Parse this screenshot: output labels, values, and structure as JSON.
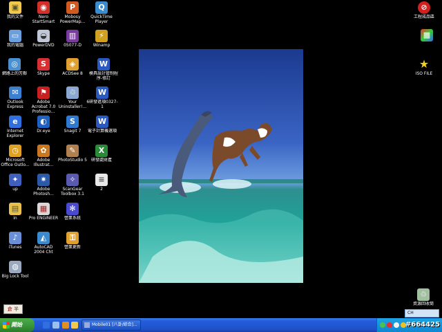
{
  "desktop_icons": [
    {
      "label": "我的文件",
      "icon": "folder-documents-icon",
      "color": "#f2c94c",
      "glyph": "▣"
    },
    {
      "label": "我的電腦",
      "icon": "computer-icon",
      "color": "#6aa0e0",
      "glyph": "▭"
    },
    {
      "label": "網路上的芳鄰",
      "icon": "network-icon",
      "color": "#4a90d0",
      "glyph": "◎"
    },
    {
      "label": "Outlook Express",
      "icon": "outlook-express-icon",
      "color": "#3a7fd0",
      "glyph": "✉"
    },
    {
      "label": "Internet Explorer",
      "icon": "internet-explorer-icon",
      "color": "#2f6fe0",
      "glyph": "e"
    },
    {
      "label": "Microsoft Office Outlo...",
      "icon": "outlook-icon",
      "color": "#e0a020",
      "glyph": "◷"
    },
    {
      "label": "up",
      "icon": "app-icon",
      "color": "#4060c0",
      "glyph": "✦"
    },
    {
      "label": "in",
      "icon": "folder-icon",
      "color": "#e9c04a",
      "glyph": "▤"
    },
    {
      "label": "iTunes",
      "icon": "itunes-icon",
      "color": "#6a8fd8",
      "glyph": "♪"
    },
    {
      "label": "Big Lock Tool",
      "icon": "lock-tool-icon",
      "color": "#9aa8c0",
      "glyph": "◍"
    },
    {
      "label": "Nero StartSmart",
      "icon": "nero-icon",
      "color": "#d0302a",
      "glyph": "◉"
    },
    {
      "label": "PowerDVD",
      "icon": "powerdvd-icon",
      "color": "#c0c8d8",
      "glyph": "◒"
    },
    {
      "label": "Skype",
      "icon": "skype-icon",
      "color": "#d83030",
      "glyph": "S"
    },
    {
      "label": "Adobe Acrobat 7.0 Professio...",
      "icon": "acrobat-icon",
      "color": "#c82020",
      "glyph": "⚑"
    },
    {
      "label": "Dr.eye",
      "icon": "dreye-icon",
      "color": "#2060c0",
      "glyph": "◐"
    },
    {
      "label": "Adobe Illustrat...",
      "icon": "illustrator-icon",
      "color": "#c87820",
      "glyph": "✿"
    },
    {
      "label": "Adobe Photosh...",
      "icon": "photoshop-icon",
      "color": "#2a5aa8",
      "glyph": "✷"
    },
    {
      "label": "Pro ENGINEER",
      "icon": "pro-engineer-icon",
      "color": "#d8d8d8",
      "glyph": "▦"
    },
    {
      "label": "AutoCAD 2004 Cht",
      "icon": "autocad-icon",
      "color": "#3a8ad0",
      "glyph": "◭"
    },
    {
      "label": "Mobosy PowerMap...",
      "icon": "powermap-icon",
      "color": "#d05a20",
      "glyph": "P"
    },
    {
      "label": "05077-D",
      "icon": "archive-icon",
      "color": "#7a3aa0",
      "glyph": "▥"
    },
    {
      "label": "ACDSee 8",
      "icon": "acdsee-icon",
      "color": "#e0a030",
      "glyph": "◈"
    },
    {
      "label": "Your Uninstaller!...",
      "icon": "recycle-bin-icon",
      "color": "#8aa8d0",
      "glyph": "♲"
    },
    {
      "label": "Snagit 7",
      "icon": "snagit-icon",
      "color": "#2f7ad0",
      "glyph": "S"
    },
    {
      "label": "PhotoStudio 5",
      "icon": "photostudio-icon",
      "color": "#b08050",
      "glyph": "✎"
    },
    {
      "label": "ScanGear Toolbox 3.1",
      "icon": "scangear-icon",
      "color": "#5a5ab0",
      "glyph": "✧"
    },
    {
      "label": "營業系統",
      "icon": "business-system-icon",
      "color": "#4a4ad0",
      "glyph": "✻"
    },
    {
      "label": "營業更新",
      "icon": "update-key-icon",
      "color": "#e0a030",
      "glyph": "⚿"
    },
    {
      "label": "QuickTime Player",
      "icon": "quicktime-icon",
      "color": "#3a8ad0",
      "glyph": "Q"
    },
    {
      "label": "Winamp",
      "icon": "winamp-icon",
      "color": "#d0a020",
      "glyph": "⚡"
    },
    {
      "label": "模具設計管制程序-修訂",
      "icon": "word-document-icon",
      "color": "#2a5ac0",
      "glyph": "W"
    },
    {
      "label": "6研發進項0327-1",
      "icon": "word-document-icon",
      "color": "#2a5ac0",
      "glyph": "W"
    },
    {
      "label": "電子計算機選項",
      "icon": "word-document-icon",
      "color": "#2a5ac0",
      "glyph": "W"
    },
    {
      "label": "研發處財產",
      "icon": "excel-document-icon",
      "color": "#2a8a3a",
      "glyph": "X"
    },
    {
      "label": "2",
      "icon": "text-document-icon",
      "color": "#e8e8e8",
      "glyph": "≡"
    },
    {
      "label": "工程成品區",
      "icon": "no-entry-icon",
      "color": "#d02020",
      "glyph": "⊘"
    },
    {
      "label": "ISO FILE",
      "icon": "star-icon",
      "color": "#f0d020",
      "glyph": "★"
    },
    {
      "label": "資源回收筒",
      "icon": "recycle-bin-icon",
      "color": "#a0c0a0",
      "glyph": "♲"
    }
  ],
  "taskbar": {
    "start_label": "開始",
    "task_label": "Mobile01 [八卦/綜合]...",
    "tray_lang": "CH",
    "watermark": "#664425"
  },
  "ime": {
    "label": "倉 半"
  },
  "colors": {
    "taskbar": "#245edb",
    "start": "#379237",
    "tray": "#0f86d0",
    "desktop": "#000000"
  }
}
